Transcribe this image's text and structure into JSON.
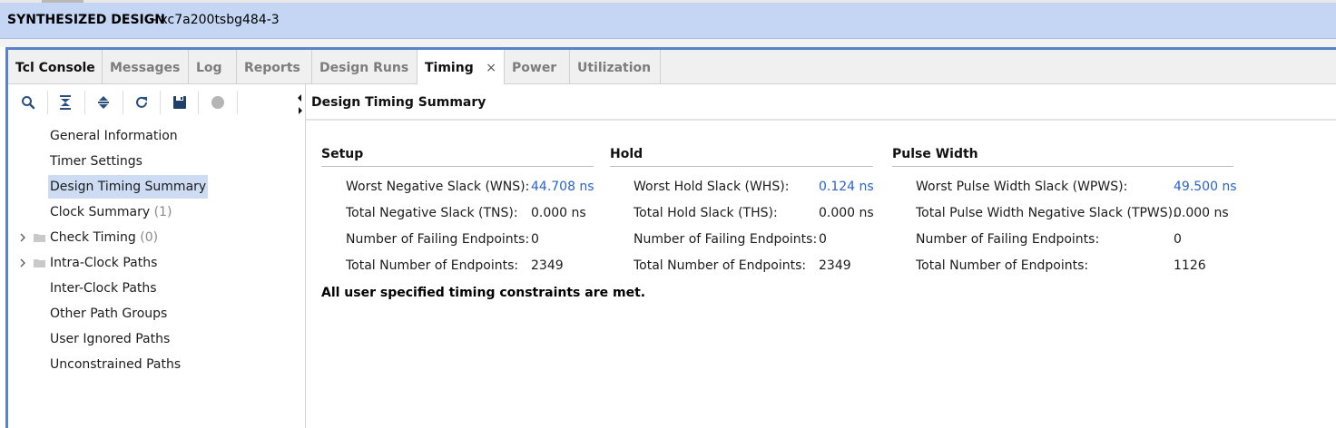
{
  "header": {
    "title": "SYNTHESIZED DESIGN",
    "subtitle": " - xc7a200tsbg484-3"
  },
  "tabs": [
    {
      "label": "Tcl Console"
    },
    {
      "label": "Messages"
    },
    {
      "label": "Log"
    },
    {
      "label": "Reports"
    },
    {
      "label": "Design Runs"
    },
    {
      "label": "Timing",
      "close": "×"
    },
    {
      "label": "Power"
    },
    {
      "label": "Utilization"
    }
  ],
  "toolbar_icons": [
    "search-icon",
    "collapse-all-icon",
    "expand-all-icon",
    "refresh-icon",
    "save-icon",
    "stop-icon"
  ],
  "tree": [
    {
      "label": "General Information"
    },
    {
      "label": "Timer Settings"
    },
    {
      "label": "Design Timing Summary"
    },
    {
      "label": "Clock Summary",
      "count": "(1)"
    },
    {
      "label": "Check Timing",
      "count": "(0)"
    },
    {
      "label": "Intra-Clock Paths"
    },
    {
      "label": "Inter-Clock Paths"
    },
    {
      "label": "Other Path Groups"
    },
    {
      "label": "User Ignored Paths"
    },
    {
      "label": "Unconstrained Paths"
    }
  ],
  "content": {
    "title": "Design Timing Summary",
    "setup": {
      "heading": "Setup",
      "rows": [
        {
          "label": "Worst Negative Slack (WNS):",
          "value": "44.708 ns"
        },
        {
          "label": "Total Negative Slack (TNS):",
          "value": "0.000 ns"
        },
        {
          "label": "Number of Failing Endpoints:",
          "value": "0"
        },
        {
          "label": "Total Number of Endpoints:",
          "value": "2349"
        }
      ]
    },
    "hold": {
      "heading": "Hold",
      "rows": [
        {
          "label": "Worst Hold Slack (WHS):",
          "value": "0.124 ns"
        },
        {
          "label": "Total Hold Slack (THS):",
          "value": "0.000 ns"
        },
        {
          "label": "Number of Failing Endpoints:",
          "value": "0"
        },
        {
          "label": "Total Number of Endpoints:",
          "value": "2349"
        }
      ]
    },
    "pulse": {
      "heading": "Pulse Width",
      "rows": [
        {
          "label": "Worst Pulse Width Slack (WPWS):",
          "value": "49.500 ns"
        },
        {
          "label": "Total Pulse Width Negative Slack (TPWS):",
          "value": "0.000 ns"
        },
        {
          "label": "Number of Failing Endpoints:",
          "value": "0"
        },
        {
          "label": "Total Number of Endpoints:",
          "value": "1126"
        }
      ]
    },
    "status": "All user specified timing constraints are met."
  },
  "colors": {
    "header_bg": "#c4d6f3",
    "frame_accent": "#5a82c8",
    "link": "#2a63c9",
    "selection": "#cddcf3"
  }
}
